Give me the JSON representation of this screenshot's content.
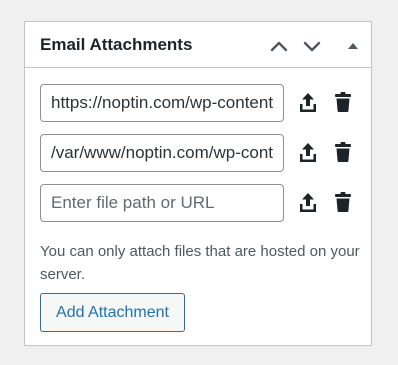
{
  "metabox": {
    "title": "Email Attachments",
    "controls": {
      "move_up_icon": "chevron-up-icon",
      "move_down_icon": "chevron-down-icon",
      "toggle_icon": "triangle-up-icon"
    }
  },
  "attachments": [
    {
      "value": "https://noptin.com/wp-content/uploads/",
      "placeholder": "Enter file path or URL"
    },
    {
      "value": "/var/www/noptin.com/wp-content/uploads/",
      "placeholder": "Enter file path or URL"
    },
    {
      "value": "",
      "placeholder": "Enter file path or URL"
    }
  ],
  "row_icons": {
    "upload": "upload-icon",
    "delete": "trash-icon"
  },
  "help_text": "You can only attach files that are hosted on your server.",
  "add_button_label": "Add Attachment",
  "colors": {
    "accent": "#2271b1",
    "border": "#c3c4c7",
    "text": "#1d2327",
    "muted_text": "#50575e",
    "page_background": "#f0f0f1"
  }
}
